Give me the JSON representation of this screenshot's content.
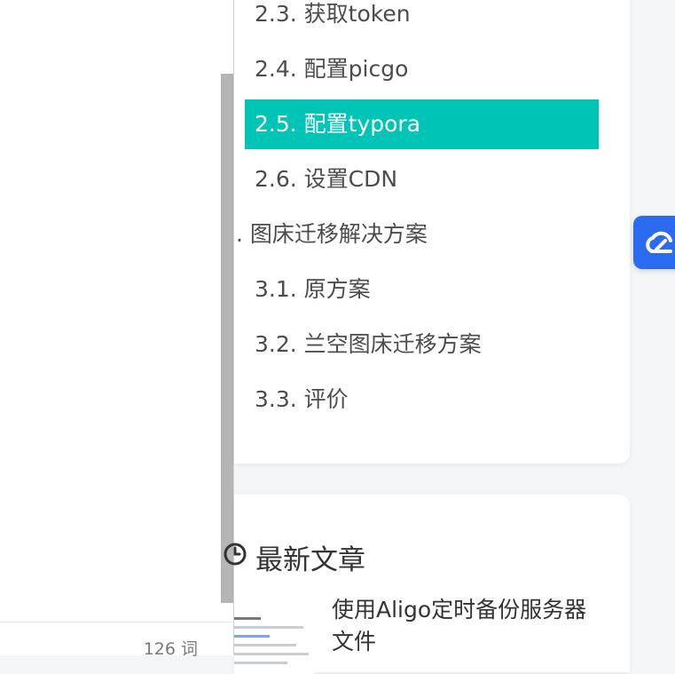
{
  "status_bar": {
    "word_count": "126 词"
  },
  "toc": {
    "items": [
      {
        "label": "2.3. 获取token",
        "level": 2,
        "active": false
      },
      {
        "label": "2.4. 配置picgo",
        "level": 2,
        "active": false
      },
      {
        "label": "2.5. 配置typora",
        "level": 2,
        "active": true
      },
      {
        "label": "2.6. 设置CDN",
        "level": 2,
        "active": false
      },
      {
        "label": ". 图床迁移解决方案",
        "level": 1,
        "active": false
      },
      {
        "label": "3.1. 原方案",
        "level": 2,
        "active": false
      },
      {
        "label": "3.2. 兰空图床迁移方案",
        "level": 2,
        "active": false
      },
      {
        "label": "3.3. 评价",
        "level": 2,
        "active": false
      }
    ]
  },
  "latest_posts": {
    "title": "最新文章",
    "icon": "clock-icon",
    "posts": [
      {
        "title": "使用Aligo定时备份服务器文件"
      }
    ]
  },
  "floating": {
    "icon": "cloud-icon"
  },
  "colors": {
    "accent": "#00c4b6",
    "float_button": "#2a6bf2",
    "scroll_thumb": "#b5b5b5"
  }
}
